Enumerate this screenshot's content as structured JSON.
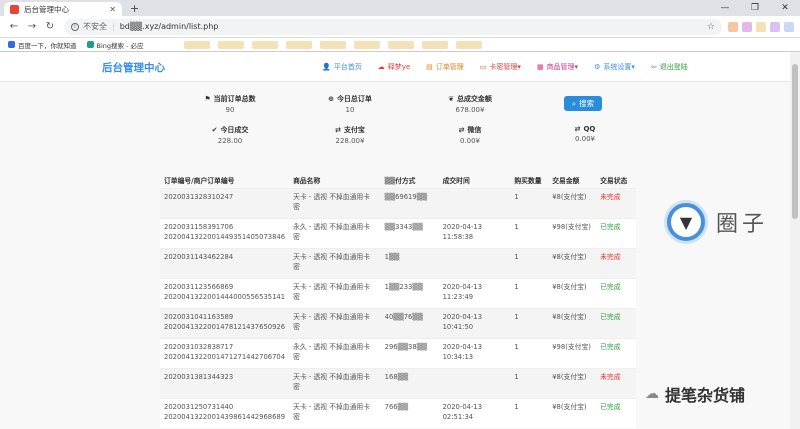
{
  "browser": {
    "tab_title": "后台管理中心",
    "address_security": "不安全",
    "address_url": "bd▒▒.xyz/admin/list.php",
    "bookmarks": [
      "百度一下，你就知道",
      "Bing搜索 - 必应"
    ]
  },
  "app": {
    "brand": "后台管理中心",
    "menu": [
      {
        "label": "平台首页",
        "icon": "home-icon",
        "color": "#3a8ee6"
      },
      {
        "label": "释梦ye",
        "icon": "cloud-icon",
        "color": "#e53935"
      },
      {
        "label": "订单管理",
        "icon": "list-icon",
        "color": "#e67e22"
      },
      {
        "label": "卡密管理▾",
        "icon": "card-icon",
        "color": "#e53935"
      },
      {
        "label": "商品管理▾",
        "icon": "grid-icon",
        "color": "#d63384"
      },
      {
        "label": "系统设置▾",
        "icon": "gear-icon",
        "color": "#3a8ee6"
      },
      {
        "label": "退出登陆",
        "icon": "logout-icon",
        "color": "#2e9d3a"
      }
    ]
  },
  "stats": [
    {
      "label": "当前订单总数",
      "value": "90",
      "icon": "flag-icon"
    },
    {
      "label": "今日总订单",
      "value": "10",
      "icon": "plus-circle-icon"
    },
    {
      "label": "总成交金额",
      "value": "678.00¥",
      "icon": "leaf-icon"
    },
    {
      "label": "今日成交",
      "value": "228.00",
      "icon": "check-icon"
    },
    {
      "label": "支付宝",
      "value": "228.00¥",
      "icon": "retweet-icon"
    },
    {
      "label": "微信",
      "value": "0.00¥",
      "icon": "retweet-icon"
    },
    {
      "label": "QQ",
      "value": "0.00¥",
      "icon": "retweet-icon"
    }
  ],
  "search_label": "搜索",
  "table": {
    "headers": [
      "订单编号/商户订单编号",
      "商品名称",
      "▒▒付方式",
      "成交时间",
      "购买数量",
      "交易金额",
      "交易状态"
    ],
    "rows": [
      {
        "order": "2020031328310247",
        "merchant": "",
        "product": "天卡 - 透视 不掉血通用卡密",
        "pay": "▒▒69619▒▒",
        "time": "",
        "time2": "",
        "qty": "1",
        "amount": "¥8(支付宝)",
        "status": "未完成",
        "ok": false
      },
      {
        "order": "2020031158391706",
        "merchant": "2020041322001449351405073846",
        "product": "永久 - 透视 不掉血通用卡密",
        "pay": "▒▒3343▒▒",
        "time": "2020-04-13",
        "time2": "11:58:38",
        "qty": "1",
        "amount": "¥98(支付宝)",
        "status": "已完成",
        "ok": true
      },
      {
        "order": "2020031143462284",
        "merchant": "",
        "product": "天卡 - 透视 不掉血通用卡密",
        "pay": "1▒▒",
        "time": "",
        "time2": "",
        "qty": "1",
        "amount": "¥8(支付宝)",
        "status": "未完成",
        "ok": false
      },
      {
        "order": "2020031123566869",
        "merchant": "2020041322001444000556535141",
        "product": "天卡 - 透视 不掉血通用卡密",
        "pay": "1▒▒233▒▒",
        "time": "2020-04-13",
        "time2": "11:23:49",
        "qty": "1",
        "amount": "¥8(支付宝)",
        "status": "已完成",
        "ok": true
      },
      {
        "order": "2020031041163589",
        "merchant": "2020041322001478121437650926",
        "product": "天卡 - 透视 不掉血通用卡密",
        "pay": "40▒▒76▒▒",
        "time": "2020-04-13",
        "time2": "10:41:50",
        "qty": "1",
        "amount": "¥8(支付宝)",
        "status": "已完成",
        "ok": true
      },
      {
        "order": "2020031032838717",
        "merchant": "2020041322001471271442706704",
        "product": "永久 - 透视 不掉血通用卡密",
        "pay": "296▒▒38▒▒",
        "time": "2020-04-13",
        "time2": "10:34:13",
        "qty": "1",
        "amount": "¥98(支付宝)",
        "status": "已完成",
        "ok": true
      },
      {
        "order": "2020031381344323",
        "merchant": "",
        "product": "天卡 - 透视 不掉血通用卡密",
        "pay": "168▒▒",
        "time": "",
        "time2": "",
        "qty": "1",
        "amount": "¥8(支付宝)",
        "status": "未完成",
        "ok": false
      },
      {
        "order": "2020031250731440",
        "merchant": "2020041322001439861442968689",
        "product": "天卡 - 透视 不掉血通用卡密",
        "pay": "766▒▒",
        "time": "2020-04-13",
        "time2": "02:51:34",
        "qty": "1",
        "amount": "¥8(支付宝)",
        "status": "已完成",
        "ok": true
      }
    ]
  },
  "watermarks": {
    "circle_text": "圈子",
    "bottom_text": "提笔杂货铺"
  },
  "colors": {
    "accent": "#3a8ee6",
    "status_ok": "#2e9d3a",
    "status_pending": "#e53935"
  }
}
